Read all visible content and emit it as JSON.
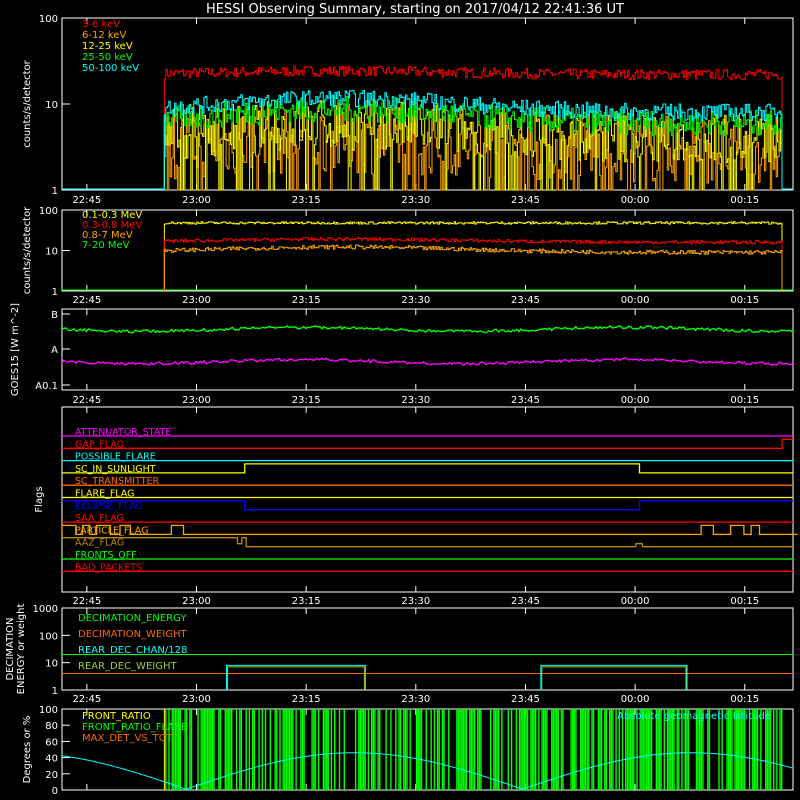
{
  "title": "HESSI Observing Summary, starting on 2017/04/12 22:41:36 UT",
  "time_ticks": [
    "22:45",
    "23:00",
    "23:15",
    "23:30",
    "23:45",
    "00:00",
    "00:15"
  ],
  "chart_data": [
    {
      "type": "line",
      "id": "lowE",
      "ylabel": "counts/s/detector",
      "yscale": "log",
      "ylim": [
        1,
        100
      ],
      "yticks": [
        "1",
        "10",
        "100"
      ],
      "data_span_minutes": [
        14,
        98.5
      ],
      "series": [
        {
          "name": "3-6 keV",
          "color": "#ff0000",
          "level": 22,
          "trend": 0.1,
          "noise": 0.06
        },
        {
          "name": "6-12 keV",
          "color": "#ffa500",
          "level": 3,
          "trend": 0.3,
          "noise": 0.4
        },
        {
          "name": "12-25 keV",
          "color": "#ffff00",
          "level": 4,
          "trend": 0.45,
          "noise": 0.3
        },
        {
          "name": "25-50 keV",
          "color": "#00ff00",
          "level": 6,
          "trend": 0.45,
          "noise": 0.15
        },
        {
          "name": "50-100 keV",
          "color": "#00ffff",
          "level": 8,
          "trend": 0.45,
          "noise": 0.1
        }
      ]
    },
    {
      "type": "line",
      "id": "highE",
      "ylabel": "counts/s/detector",
      "yscale": "log",
      "ylim": [
        1,
        100
      ],
      "yticks": [
        "1",
        "10",
        "100"
      ],
      "data_span_minutes": [
        14,
        98.5
      ],
      "series": [
        {
          "name": "0.1-0.3 MeV",
          "color": "#ffff00",
          "level": 48,
          "trend": 0.0,
          "noise": 0.03
        },
        {
          "name": "0.3-0.8 MeV",
          "color": "#ff0000",
          "level": 16,
          "trend": 0.2,
          "noise": 0.04
        },
        {
          "name": "0.8-7 MeV",
          "color": "#ffa500",
          "level": 9,
          "trend": 0.35,
          "noise": 0.05
        },
        {
          "name": "7-20 MeV",
          "color": "#00ff00",
          "level": 1,
          "trend": 0.0,
          "noise": 0.0
        }
      ]
    },
    {
      "type": "line",
      "id": "goes",
      "ylabel": "GOES15 [W m^-2]",
      "yticks": [
        "B",
        "A",
        "A0.1"
      ],
      "series": [
        {
          "name": "long",
          "color": "#00ff00",
          "level": 0.75
        },
        {
          "name": "short",
          "color": "#ff00ff",
          "level": 0.35
        }
      ]
    },
    {
      "type": "line",
      "id": "flags",
      "ylabel": "Flags",
      "series": [
        {
          "name": "ATTENUATOR_STATE",
          "color": "#ff00ff"
        },
        {
          "name": "GAP_FLAG",
          "color": "#ff0000"
        },
        {
          "name": "POSSIBLE_FLARE",
          "color": "#00ffff"
        },
        {
          "name": "SC_IN_SUNLIGHT",
          "color": "#ffff00"
        },
        {
          "name": "SC_TRANSMITTER",
          "color": "#ff6a00"
        },
        {
          "name": "FLARE_FLAG",
          "color": "#ffff00"
        },
        {
          "name": "ECLIPSE_FLAG",
          "color": "#0000ff"
        },
        {
          "name": "SAA_FLAG",
          "color": "#ff0000"
        },
        {
          "name": "PARTICLE_FLAG",
          "color": "#ffa500"
        },
        {
          "name": "AAZ_FLAG",
          "color": "#b8860b"
        },
        {
          "name": "FRONTS_OFF",
          "color": "#00ff00"
        },
        {
          "name": "BAD_PACKETS",
          "color": "#ff0000"
        }
      ]
    },
    {
      "type": "line",
      "id": "decim",
      "ylabel": "DECIMATION ENERGY or weight",
      "yscale": "log",
      "ylim": [
        1,
        1000
      ],
      "yticks": [
        "1",
        "10",
        "100",
        "1000"
      ],
      "series": [
        {
          "name": "DECIMATION_ENERGY",
          "color": "#00ff00"
        },
        {
          "name": "DECIMATION_WEIGHT",
          "color": "#ff6a00"
        },
        {
          "name": "REAR_DEC_CHAN/128",
          "color": "#00ffff"
        },
        {
          "name": "REAR_DEC_WEIGHT",
          "color": "#9acd32"
        }
      ]
    },
    {
      "type": "line",
      "id": "ratio",
      "ylabel": "Degrees or %",
      "ylim": [
        0,
        100
      ],
      "yticks": [
        "0",
        "20",
        "40",
        "60",
        "80",
        "100"
      ],
      "series": [
        {
          "name": "FRONT_RATIO",
          "color": "#ffff00"
        },
        {
          "name": "FRONT_RATIO_FLARE",
          "color": "#00ff00"
        },
        {
          "name": "MAX_DET_VS_TOT",
          "color": "#ff6a00"
        },
        {
          "name": "Absolute geomagnetic latitude",
          "color": "#00ffff"
        }
      ]
    }
  ]
}
